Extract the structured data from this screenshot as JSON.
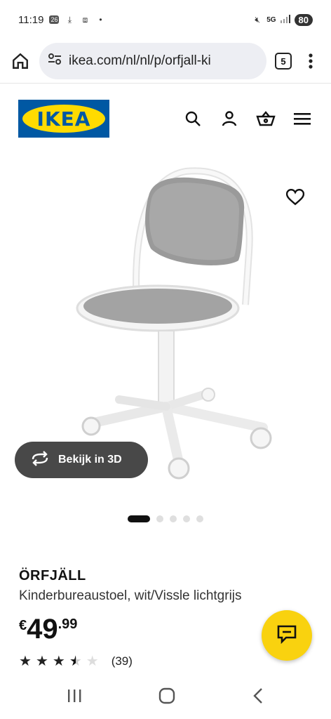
{
  "status_bar": {
    "time": "11:19",
    "battery": "80",
    "notif_badge": "26"
  },
  "browser": {
    "url": "ikea.com/nl/nl/p/orfjall-ki",
    "tab_count": "5"
  },
  "brand": {
    "logo_text": "IKEA",
    "blue": "#0058a3",
    "yellow": "#ffdb00"
  },
  "product_image": {
    "view_3d_label": "Bekijk in 3D",
    "carousel_total": 5,
    "carousel_active": 1
  },
  "product": {
    "name": "ÖRFJÄLL",
    "description": "Kinderbureaustoel, wit/Vissle lichtgrijs",
    "price_currency": "€",
    "price_int": "49",
    "price_dec": ".99",
    "rating": 3.5,
    "rating_max": 5,
    "review_count": "(39)"
  },
  "chat": {
    "accent": "#f9d20f"
  }
}
